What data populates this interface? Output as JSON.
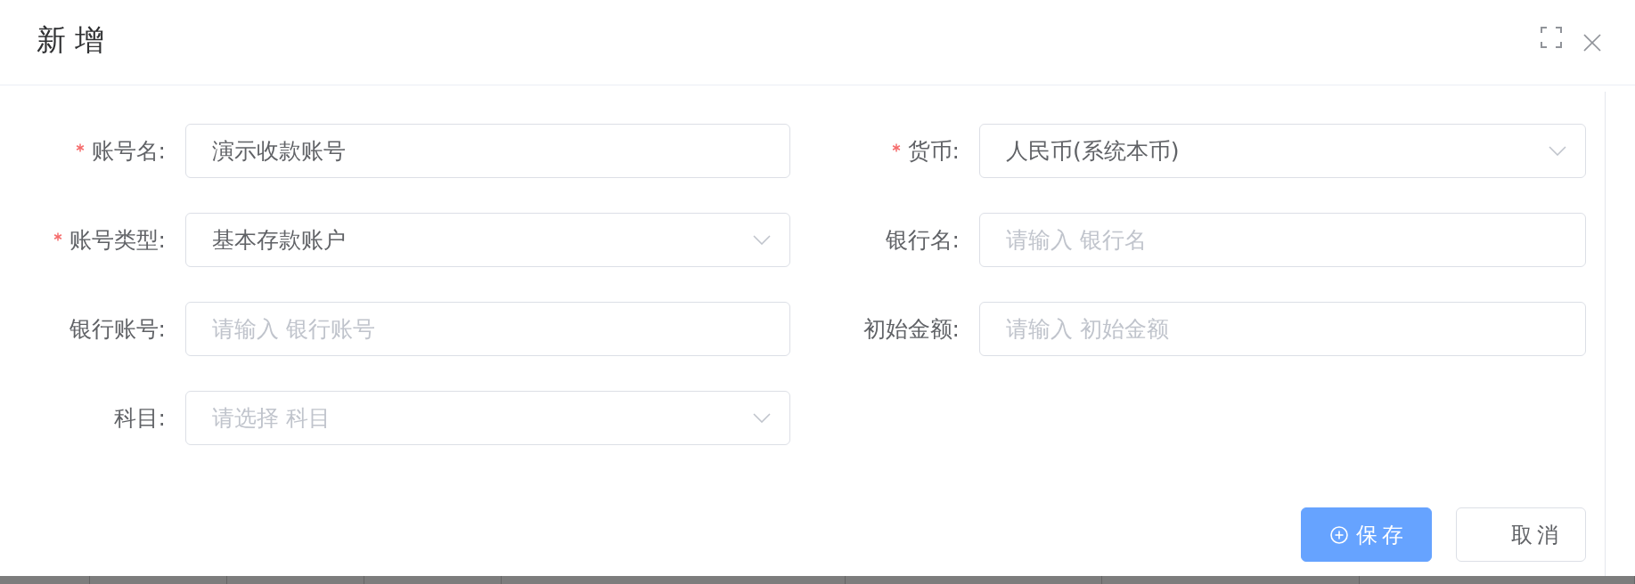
{
  "dialog": {
    "title": "新 增"
  },
  "fields": [
    {
      "label": "账号名:",
      "required": true,
      "kind": "input",
      "value": "演示收款账号"
    },
    {
      "label": "货币:",
      "required": true,
      "kind": "select",
      "value": "人民币(系统本币)"
    },
    {
      "label": "账号类型:",
      "required": true,
      "kind": "select",
      "value": "基本存款账户"
    },
    {
      "label": "银行名:",
      "required": false,
      "kind": "input",
      "placeholder": "请输入 银行名"
    },
    {
      "label": "银行账号:",
      "required": false,
      "kind": "input",
      "placeholder": "请输入 银行账号"
    },
    {
      "label": "初始金额:",
      "required": false,
      "kind": "input",
      "placeholder": "请输入 初始金额"
    },
    {
      "label": "科目:",
      "required": false,
      "kind": "select",
      "placeholder": "请选择 科目"
    }
  ],
  "buttons": [
    {
      "label": "保存",
      "kind": "primary"
    },
    {
      "label": "取消",
      "kind": "default"
    }
  ]
}
